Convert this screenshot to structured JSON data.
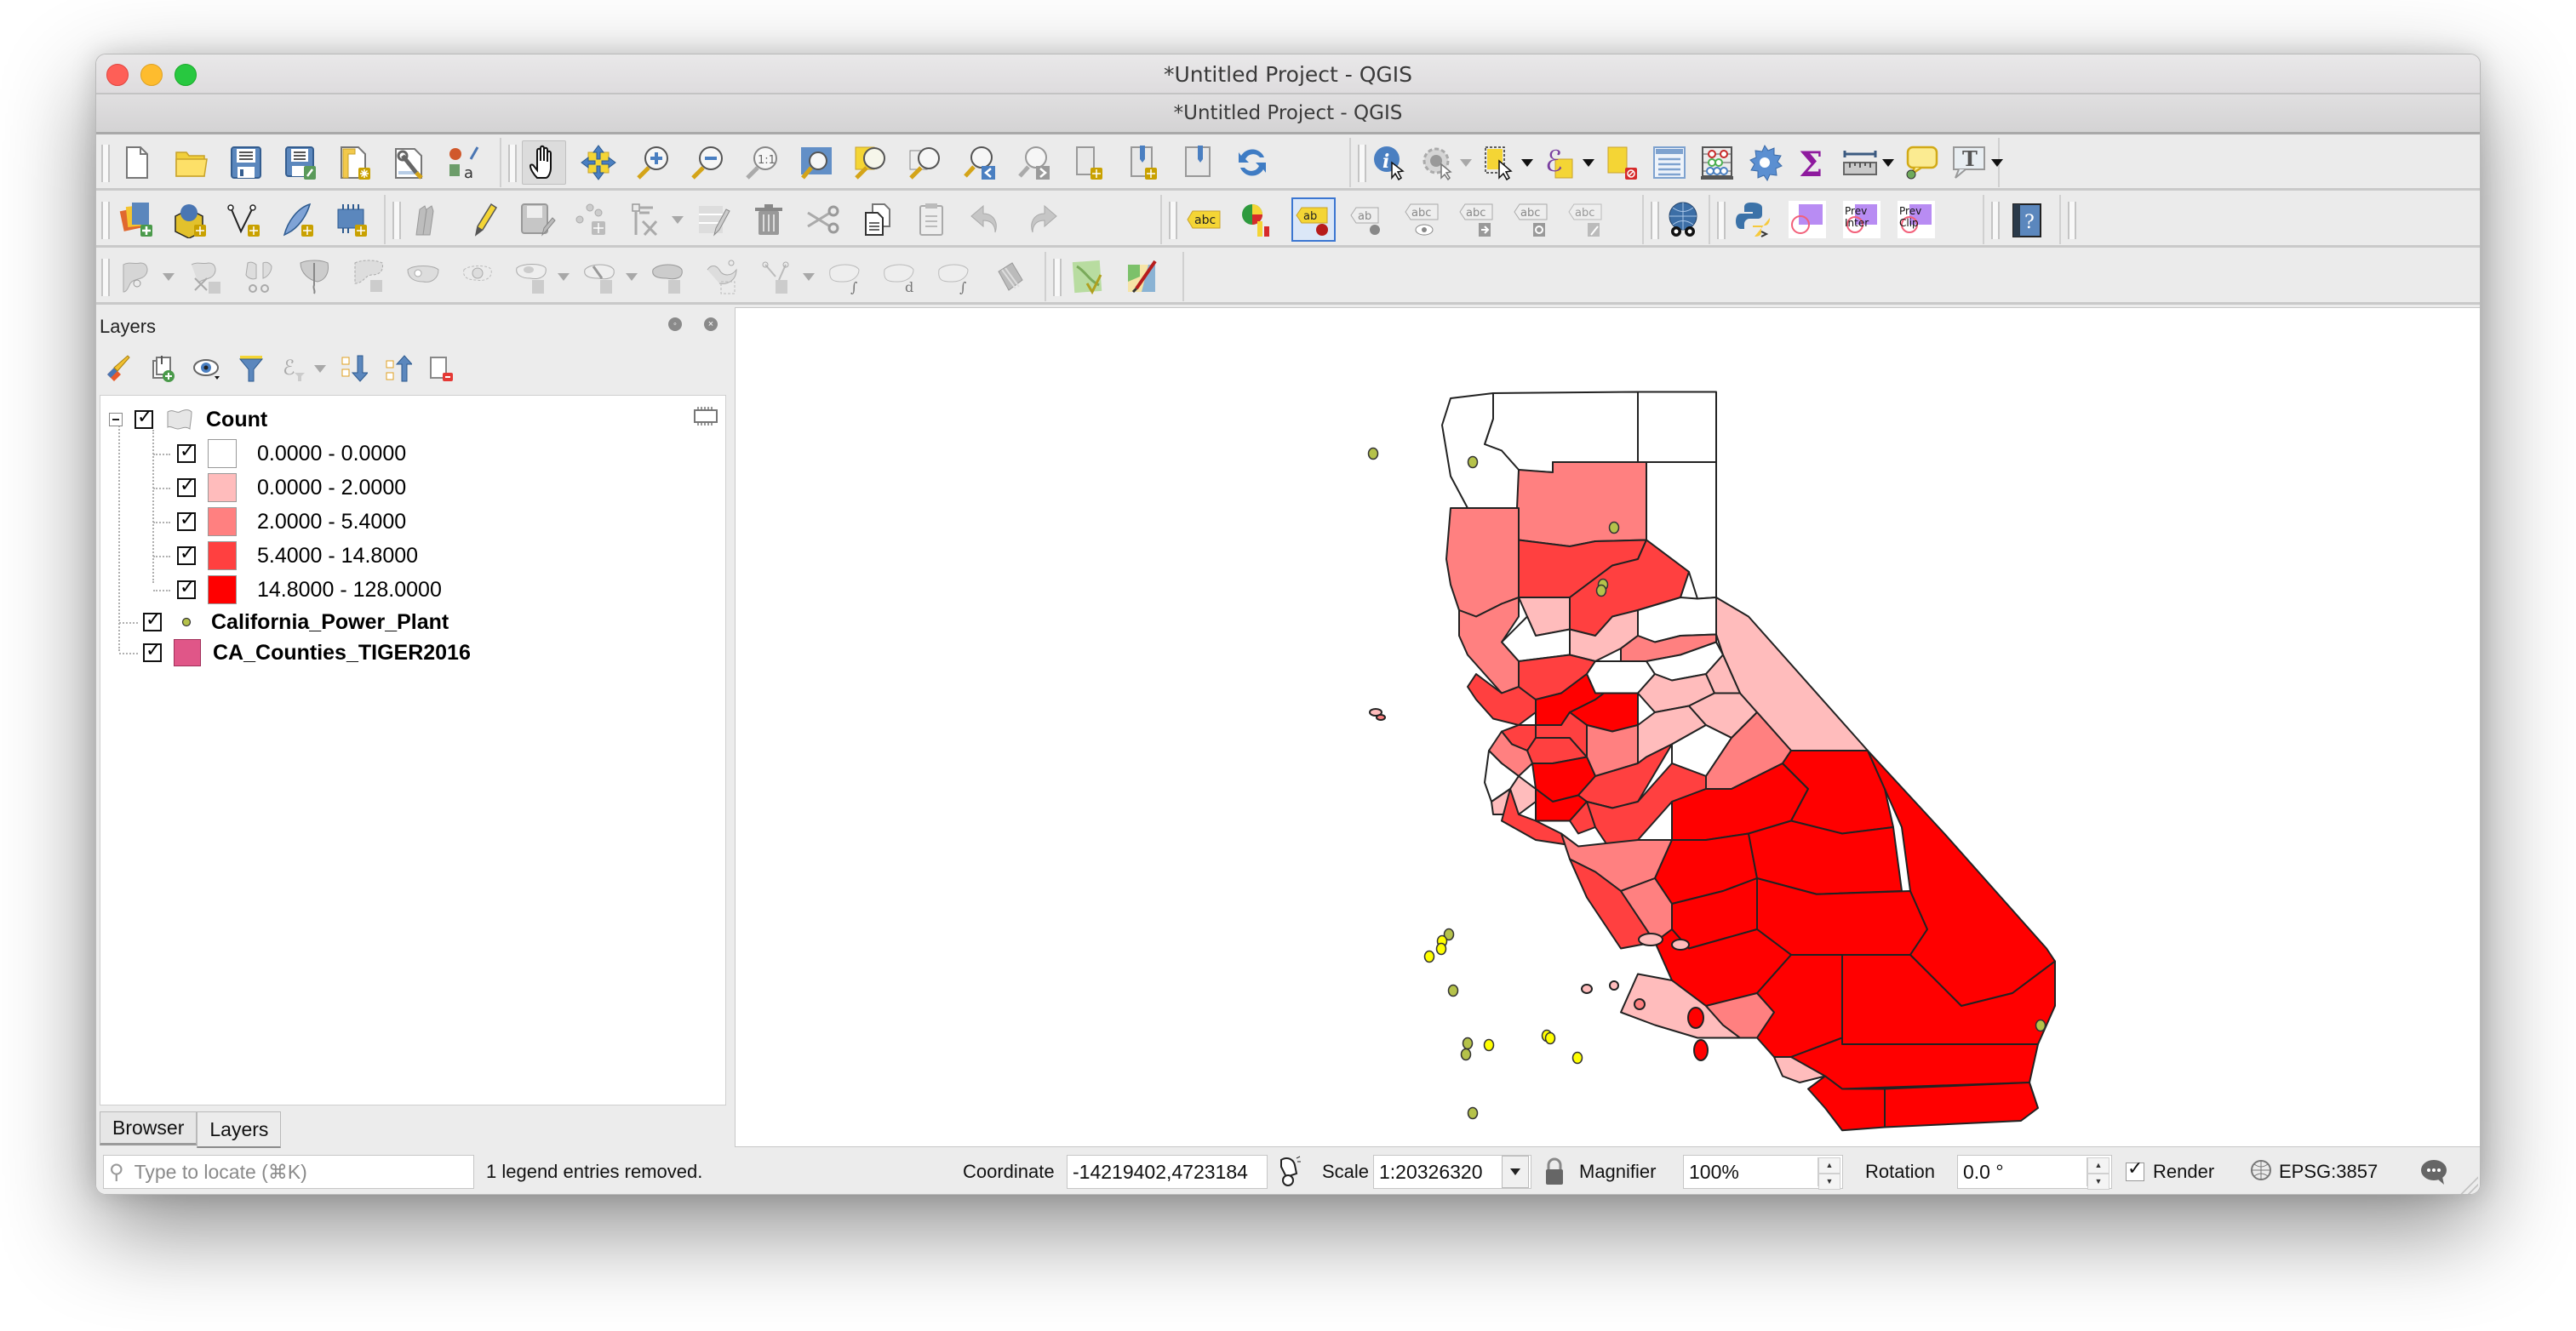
{
  "window": {
    "title": "*Untitled Project - QGIS",
    "subtitle": "*Untitled Project - QGIS"
  },
  "toolbars": {
    "row1": [
      {
        "group": "project",
        "items": [
          "new-project",
          "open-project",
          "save-project",
          "save-project-as",
          "new-print-layout",
          "layout-manager",
          "style-manager"
        ]
      },
      {
        "group": "map-navigation",
        "items": [
          "pan-map",
          "pan-to-selection",
          "zoom-in",
          "zoom-out",
          "zoom-native",
          "zoom-full",
          "zoom-to-selection",
          "zoom-to-layer",
          "zoom-last",
          "zoom-next",
          "new-map-view",
          "new-bookmark",
          "show-bookmarks",
          "refresh"
        ]
      },
      {
        "group": "attributes",
        "items": [
          "identify-features",
          "run-feature-action",
          "select-features",
          "select-by-expression",
          "deselect-all",
          "open-attribute-table",
          "field-calculator",
          "processing-toolbox",
          "statistical-summary",
          "measure",
          "map-tips",
          "text-annotation"
        ]
      }
    ],
    "row2": [
      {
        "group": "data-source",
        "items": [
          "data-source-manager",
          "new-geopackage-layer",
          "new-shapefile-layer",
          "new-spatialite-layer",
          "new-temporary-scratch-layer"
        ]
      },
      {
        "group": "digitizing",
        "items": [
          "current-edits",
          "toggle-editing",
          "save-layer-edits",
          "add-point-feature",
          "vertex-tool",
          "modify-attributes",
          "delete-selected",
          "cut-features",
          "copy-features",
          "paste-features",
          "undo",
          "redo"
        ]
      },
      {
        "group": "labels",
        "items": [
          "label-toolbar",
          "layer-diagram",
          "pin-labels",
          "highlight-pinned",
          "show-hide-labels",
          "move-label",
          "rotate-label",
          "change-label"
        ]
      },
      {
        "group": "metasearch",
        "items": [
          "metasearch"
        ]
      },
      {
        "group": "plugins",
        "items": [
          "python-console",
          "preview-intersection",
          "prev-inter",
          "prev-clip"
        ]
      },
      {
        "group": "help",
        "items": [
          "help-contents"
        ]
      }
    ],
    "row3": [
      {
        "group": "advanced-digitizing",
        "items": [
          "reshape-features",
          "split-features",
          "split-parts",
          "merge-selected",
          "delete-ring",
          "delete-part",
          "fill-ring",
          "add-ring",
          "add-part",
          "offset-curve",
          "simplify",
          "rotate-feature",
          "trace",
          "reverse-line"
        ]
      },
      {
        "group": "gps",
        "items": [
          "gps-tools",
          "georeferencer"
        ]
      }
    ],
    "icon_text": {
      "prev_inter": [
        "Prev",
        "Inter"
      ],
      "prev_clip": [
        "Prev",
        "Clip"
      ]
    }
  },
  "layers_panel": {
    "title": "Layers",
    "tools": [
      "open-layer-styling",
      "add-group",
      "manage-visibility",
      "filter-legend",
      "filter-by-expression",
      "expand-all",
      "collapse-all",
      "remove-layer"
    ],
    "layers": [
      {
        "name": "Count",
        "checked": true,
        "expanded": true,
        "legend": [
          {
            "label": "0.0000 - 0.0000",
            "color": "#ffffff",
            "checked": true
          },
          {
            "label": "0.0000 - 2.0000",
            "color": "#ffbcbc",
            "checked": true
          },
          {
            "label": "2.0000 - 5.4000",
            "color": "#ff8080",
            "checked": true
          },
          {
            "label": "5.4000 - 14.8000",
            "color": "#ff4040",
            "checked": true
          },
          {
            "label": "14.8000 - 128.0000",
            "color": "#ff0000",
            "checked": true
          }
        ]
      },
      {
        "name": "California_Power_Plant",
        "checked": true,
        "symbol_color": "#b5c24a"
      },
      {
        "name": "CA_Counties_TIGER2016",
        "checked": true,
        "symbol_color": "#e05688"
      }
    ],
    "tabs": [
      {
        "label": "Browser",
        "active": false
      },
      {
        "label": "Layers",
        "active": true
      }
    ]
  },
  "status_bar": {
    "locate_placeholder": "Type to locate (⌘K)",
    "message": "1 legend entries removed.",
    "coordinate_label": "Coordinate",
    "coordinate_value": "-14219402,4723184",
    "scale_label": "Scale",
    "scale_value": "1:20326320",
    "magnifier_label": "Magnifier",
    "magnifier_value": "100%",
    "rotation_label": "Rotation",
    "rotation_value": "0.0 °",
    "render_label": "Render",
    "render_checked": true,
    "crs": "EPSG:3857"
  },
  "map": {
    "colors": {
      "class0": "#ffffff",
      "class1": "#ffbcbc",
      "class2": "#ff8080",
      "class3": "#ff4040",
      "class4": "#ff0000",
      "point_green": "#b5c24a",
      "point_yellow": "#ffff00",
      "outline": "#222222"
    }
  }
}
